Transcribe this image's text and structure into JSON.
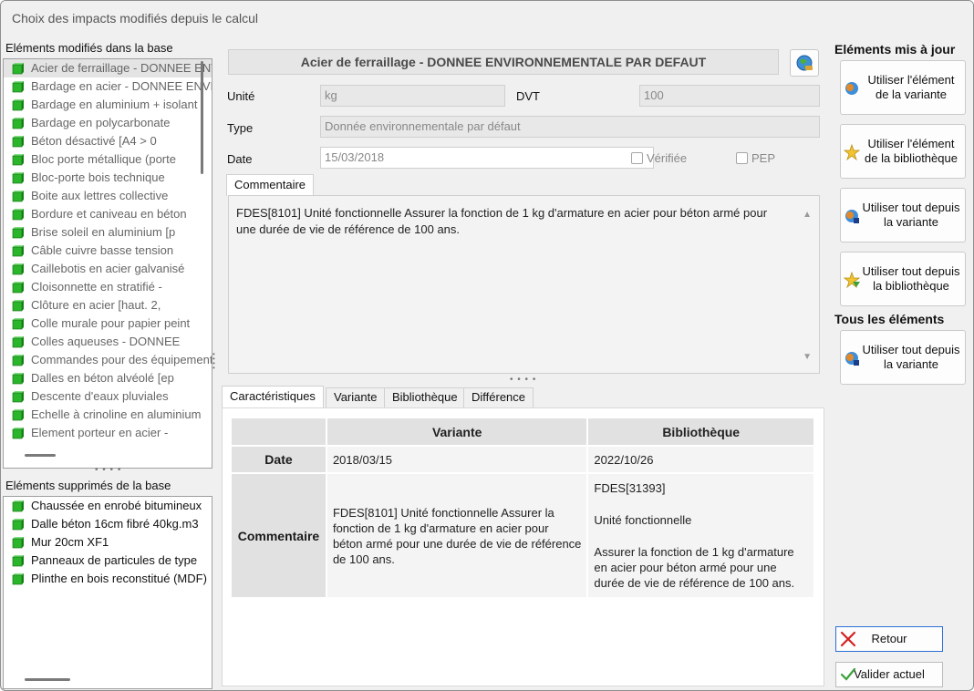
{
  "window": {
    "title": "Choix des impacts modifiés depuis le calcul"
  },
  "modified": {
    "label": "Eléments modifiés dans la base",
    "items": [
      "Acier de ferraillage - DONNEE ENVIRONNEMENTALE PAR DEFAUT",
      "Bardage en acier - DONNEE ENVIRONNEMENTALE",
      "Bardage en aluminium + isolant",
      "Bardage en polycarbonate",
      "Béton désactivé [A4 > 0",
      "Bloc porte métallique (porte",
      "Bloc-porte bois technique",
      "Boite aux lettres collective",
      "Bordure et caniveau en béton",
      "Brise soleil en aluminium [p",
      "Câble cuivre basse tension",
      "Caillebotis en acier galvanisé",
      "Cloisonnette en stratifié -",
      "Clôture en acier [haut. 2,",
      "Colle murale pour papier peint",
      "Colles aqueuses - DONNEE",
      "Commandes pour des équipements",
      "Dalles en béton alvéolé [ep",
      "Descente d'eaux pluviales",
      "Echelle à crinoline en aluminium",
      "Element porteur en acier -"
    ]
  },
  "deleted": {
    "label": "Eléments supprimés de la base",
    "items": [
      "Chaussée en enrobé bitumineux",
      "Dalle béton 16cm fibré 40kg.m3",
      "Mur 20cm XF1",
      "Panneaux de particules de type",
      "Plinthe en bois reconstitué (MDF)"
    ]
  },
  "detail": {
    "title": "Acier de ferraillage - DONNEE ENVIRONNEMENTALE PAR DEFAUT",
    "unit_label": "Unité",
    "unit_value": "kg",
    "dvt_label": "DVT",
    "dvt_value": "100",
    "type_label": "Type",
    "type_value": "Donnée environnementale par défaut",
    "date_label": "Date",
    "date_value": "15/03/2018",
    "verified_label": "Vérifiée",
    "pep_label": "PEP",
    "comment_tab": "Commentaire",
    "comment_text": "FDES[8101] Unité fonctionnelle Assurer la fonction de 1 kg d'armature en acier pour béton armé pour une durée de vie de référence de 100 ans."
  },
  "tabs": [
    "Caractéristiques",
    "Variante",
    "Bibliothèque",
    "Différence"
  ],
  "compare": {
    "col_variante": "Variante",
    "col_bibliotheque": "Bibliothèque",
    "row_date": "Date",
    "row_comment": "Commentaire",
    "date_variante": "2018/03/15",
    "date_bibliotheque": "2022/10/26",
    "comment_variante": "FDES[8101] Unité fonctionnelle Assurer la fonction de 1 kg d'armature en acier pour béton armé pour une durée de vie de référence de 100 ans.",
    "comment_biblio_1": "FDES[31393]",
    "comment_biblio_2": "Unité fonctionnelle",
    "comment_biblio_3": "Assurer la fonction de 1 kg d'armature en acier pour béton armé pour une durée de vie de référence de 100 ans."
  },
  "actions": {
    "updated_title": "Eléments mis à jour",
    "use_variant_line1": "Utiliser l'élément",
    "use_variant_line2": "de la variante",
    "use_library_line1": "Utiliser l'élément",
    "use_library_line2": "de la bibliothèque",
    "use_all_variant_line1": "Utiliser tout depuis",
    "use_all_variant_line2": "la variante",
    "use_all_library_line1": "Utiliser tout depuis",
    "use_all_library_line2": "la bibliothèque",
    "all_title": "Tous les éléments",
    "all_use_variant_line1": "Utiliser tout depuis",
    "all_use_variant_line2": "la variante",
    "back": "Retour",
    "validate": "Valider actuel"
  },
  "colors": {
    "cube_green": "#2bb52b",
    "focus_blue": "#2b6fd6",
    "cancel_red": "#d42020",
    "ok_green": "#3aa03a"
  }
}
